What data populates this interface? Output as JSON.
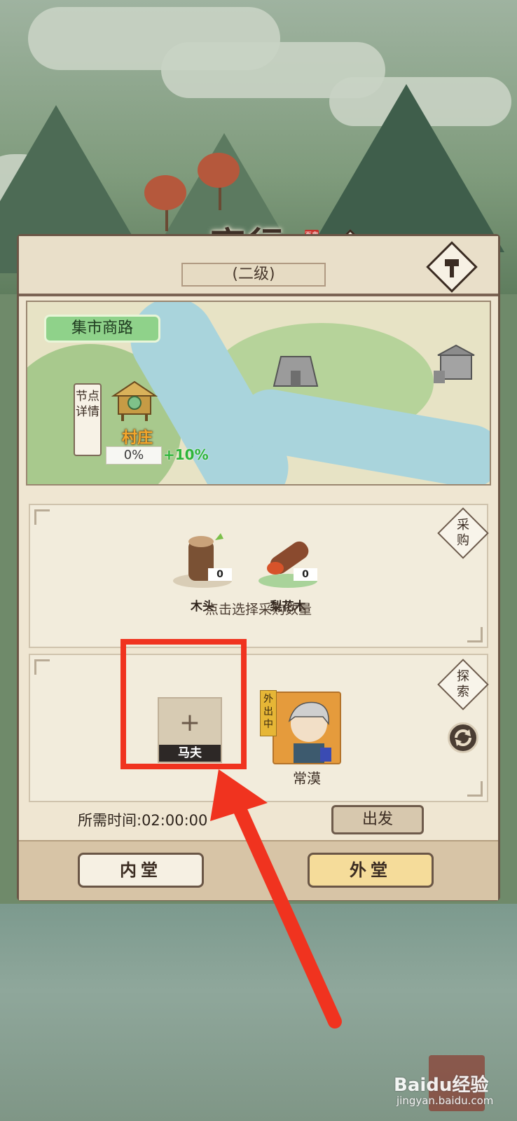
{
  "screen": {
    "title": "商行",
    "title_seal": "百鬼",
    "level": "(二级)",
    "help_label": "?"
  },
  "map": {
    "route_name": "集市商路",
    "node_details": "节点详情",
    "village": {
      "name": "村庄",
      "progress": "0%",
      "bonus": "+10%"
    }
  },
  "purchase": {
    "button_label": "采购",
    "items": [
      {
        "name": "木头",
        "count": "0",
        "icon": "wood-log-icon"
      },
      {
        "name": "梨花木",
        "count": "0",
        "icon": "pear-wood-icon"
      }
    ],
    "hint": "点击选择采购数量"
  },
  "explore": {
    "button_label": "探索",
    "slot_label": "马夫",
    "slot_plus": "+",
    "hero": {
      "status": "外出中",
      "name": "常漠"
    }
  },
  "footer": {
    "time_text": "所需时间:02:00:00",
    "depart_label": "出发",
    "tab_inner": "内堂",
    "tab_outer": "外堂"
  },
  "watermark": {
    "brand": "Baidu经验",
    "url": "jingyan.baidu.com"
  },
  "colors": {
    "highlight_box": "#f0331f",
    "arrow": "#f0331f",
    "bonus_green": "#2fb53a",
    "village_label": "#f3a72c"
  }
}
